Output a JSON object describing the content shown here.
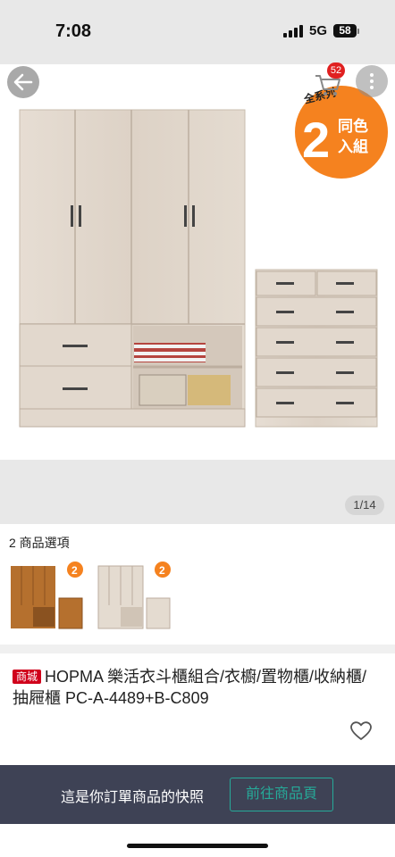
{
  "status": {
    "time": "7:08",
    "network": "5G",
    "battery": "58"
  },
  "nav": {
    "cart_count": "52"
  },
  "promo": {
    "series": "全系列",
    "big_number": "2",
    "line1": "同色",
    "line2": "入組"
  },
  "gallery": {
    "counter": "1/14"
  },
  "options": {
    "title": "2 商品選項",
    "items": [
      {
        "badge": "2"
      },
      {
        "badge": "2"
      }
    ]
  },
  "product": {
    "mall_tag": "商城",
    "title": "HOPMA 樂活衣斗櫃組合/衣櫥/置物櫃/收納櫃/抽屜櫃 PC-A-4489+B-C809"
  },
  "bottom": {
    "snapshot_text": "這是你訂單商品的快照",
    "go_button": "前往商品頁"
  },
  "colors": {
    "accent": "#f5821f",
    "bar": "#3e4255",
    "button": "#26aa99",
    "tag": "#d0011b"
  }
}
